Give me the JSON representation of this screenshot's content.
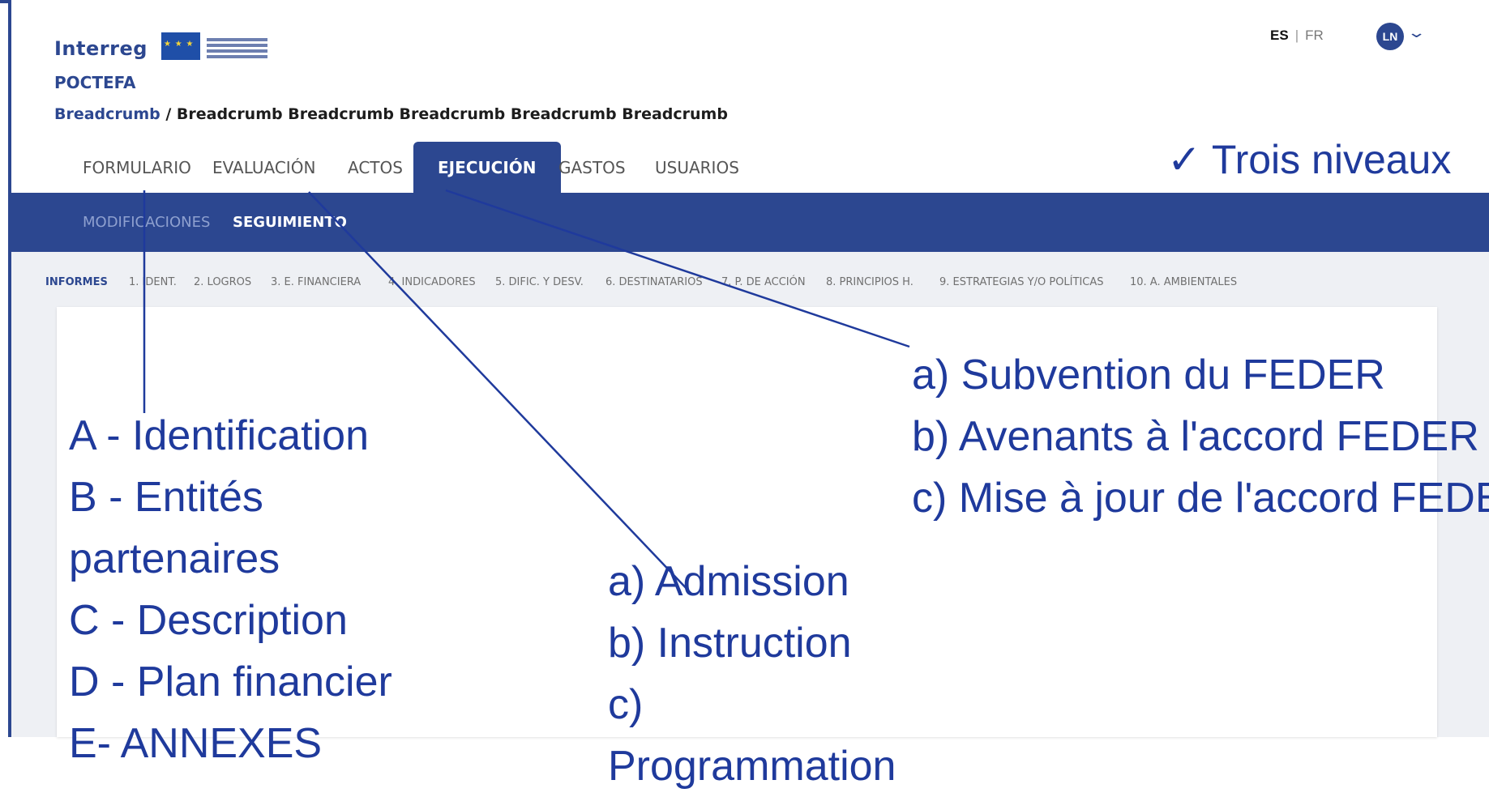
{
  "logo": {
    "interreg": "Interreg",
    "poctefa": "POCTEFA"
  },
  "lang": {
    "es": "ES",
    "fr": "FR"
  },
  "user": {
    "initials": "LN"
  },
  "breadcrumb": {
    "link": "Breadcrumb",
    "sep": " / ",
    "rest": "Breadcrumb Breadcrumb Breadcrumb Breadcrumb Breadcrumb"
  },
  "tabs": [
    {
      "label": "FORMULARIO"
    },
    {
      "label": "EVALUACIÓN"
    },
    {
      "label": "ACTOS"
    },
    {
      "label": "EJECUCIÓN"
    },
    {
      "label": "GASTOS"
    },
    {
      "label": "USUARIOS"
    }
  ],
  "subtabs": [
    {
      "label": "MODIFICACIONES"
    },
    {
      "label": "SEGUIMIENTO"
    }
  ],
  "sections": [
    {
      "label": "INFORMES"
    },
    {
      "label": "1. IDENT."
    },
    {
      "label": "2. LOGROS"
    },
    {
      "label": "3. E. FINANCIERA"
    },
    {
      "label": "4. INDICADORES"
    },
    {
      "label": "5. DIFIC. Y DESV."
    },
    {
      "label": "6. DESTINATARIOS"
    },
    {
      "label": "7. P. DE ACCIÓN"
    },
    {
      "label": "8. PRINCIPIOS H."
    },
    {
      "label": "9. ESTRATEGIAS Y/O POLÍTICAS"
    },
    {
      "label": "10. A. AMBIENTALES"
    }
  ],
  "annotations": {
    "levels": "✓ Trois niveaux",
    "formulario": [
      "A - Identification",
      "B - Entités",
      "partenaires",
      "C - Description",
      "D - Plan financier",
      "E- ANNEXES"
    ],
    "evaluacion": [
      "a) Admission",
      "b) Instruction",
      "c)",
      "Programmation"
    ],
    "actos": [
      "a) Subvention du FEDER",
      "b) Avenants à l'accord FEDER",
      "c) Mise à jour de l'accord FEDER"
    ]
  },
  "colors": {
    "brand": "#2c4790",
    "annotation": "#1f3a9c"
  }
}
